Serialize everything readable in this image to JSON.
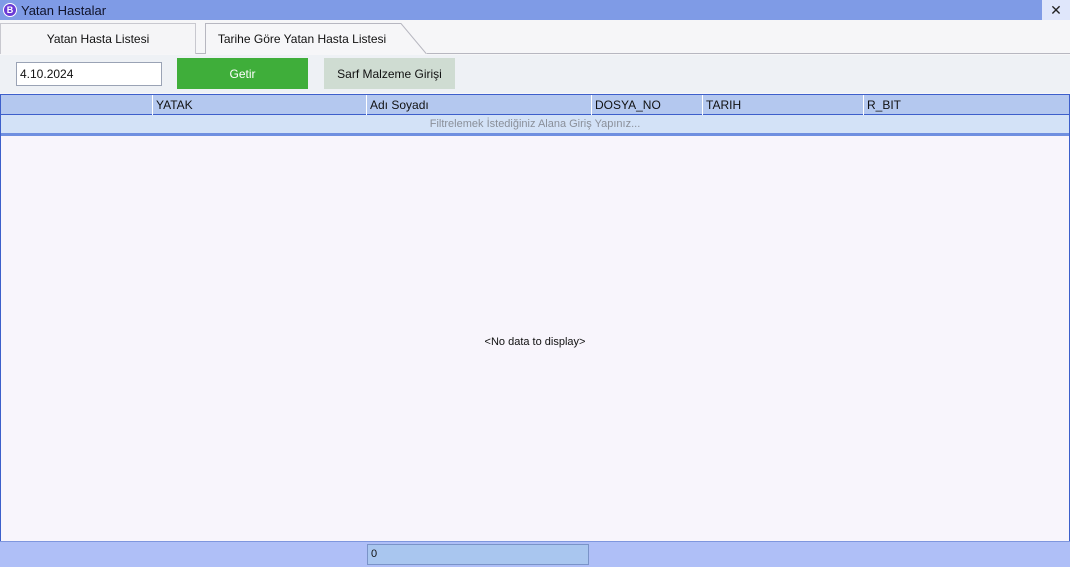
{
  "window": {
    "title": "Yatan Hastalar",
    "icon_letter": "B",
    "close_glyph": "✕"
  },
  "tabs": [
    {
      "label": "Yatan Hasta Listesi"
    },
    {
      "label": "Tarihe Göre Yatan Hasta Listesi"
    }
  ],
  "toolbar": {
    "date_value": "4.10.2024",
    "getir_label": "Getir",
    "sarf_label": "Sarf Malzeme Girişi"
  },
  "grid": {
    "columns": [
      "YATAK",
      "Adı Soyadı",
      "DOSYA_NO",
      "TARIH",
      "R_BIT"
    ],
    "filter_placeholder": "Filtrelemek İstediğiniz Alana Giriş Yapınız...",
    "empty_text": "<No data to display>"
  },
  "footer": {
    "count": "0"
  },
  "colors": {
    "title_bar": "#7f9be6",
    "getir_button": "#3fae3a",
    "sarf_button": "#cfdcd2",
    "grid_header": "#b4c8ef",
    "footer": "#afbff7"
  }
}
